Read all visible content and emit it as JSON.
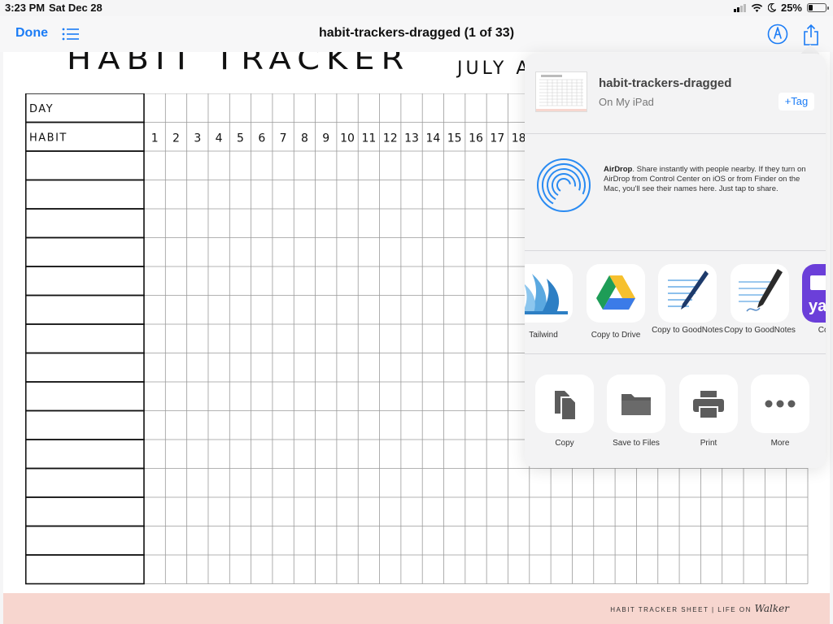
{
  "status_bar": {
    "time": "3:23 PM",
    "date": "Sat Dec 28",
    "battery": "25%",
    "battery_level": 0.25
  },
  "nav": {
    "done_label": "Done",
    "title": "habit-trackers-dragged (1 of 33)",
    "accent_color": "#1b7cf6"
  },
  "document": {
    "title": "HABIT TRACKER",
    "subtitle": "JULY A",
    "row_labels": {
      "day": "DAY",
      "habit": "HABIT"
    },
    "day_numbers": [
      "1",
      "2",
      "3",
      "4",
      "5",
      "6",
      "7",
      "8",
      "9",
      "10",
      "11",
      "12",
      "13",
      "14",
      "15",
      "16",
      "17",
      "18"
    ],
    "footer": {
      "text": "HABIT TRACKER SHEET | LIFE ON",
      "script": "Walker",
      "color": "#f7d6cf"
    }
  },
  "share_sheet": {
    "file_name": "habit-trackers-dragged",
    "file_location": "On My iPad",
    "tag_button": "+Tag",
    "airdrop": {
      "title": "AirDrop",
      "text": ". Share instantly with people nearby. If they turn on AirDrop from Control Center on iOS or from Finder on the Mac, you'll see their names here. Just tap to share."
    },
    "apps": [
      {
        "label": "Tailwind",
        "icon": "tailwind-icon"
      },
      {
        "label": "Copy to Drive",
        "icon": "google-drive-icon"
      },
      {
        "label": "Copy to GoodNotes",
        "icon": "goodnotes-icon"
      },
      {
        "label": "Copy to GoodNotes",
        "icon": "goodnotes-icon"
      },
      {
        "label": "Co Yah",
        "icon": "yahoo-icon"
      }
    ],
    "actions": [
      {
        "label": "Copy",
        "icon": "copy-icon"
      },
      {
        "label": "Save to Files",
        "icon": "folder-icon"
      },
      {
        "label": "Print",
        "icon": "printer-icon"
      },
      {
        "label": "More",
        "icon": "more-icon"
      }
    ]
  }
}
